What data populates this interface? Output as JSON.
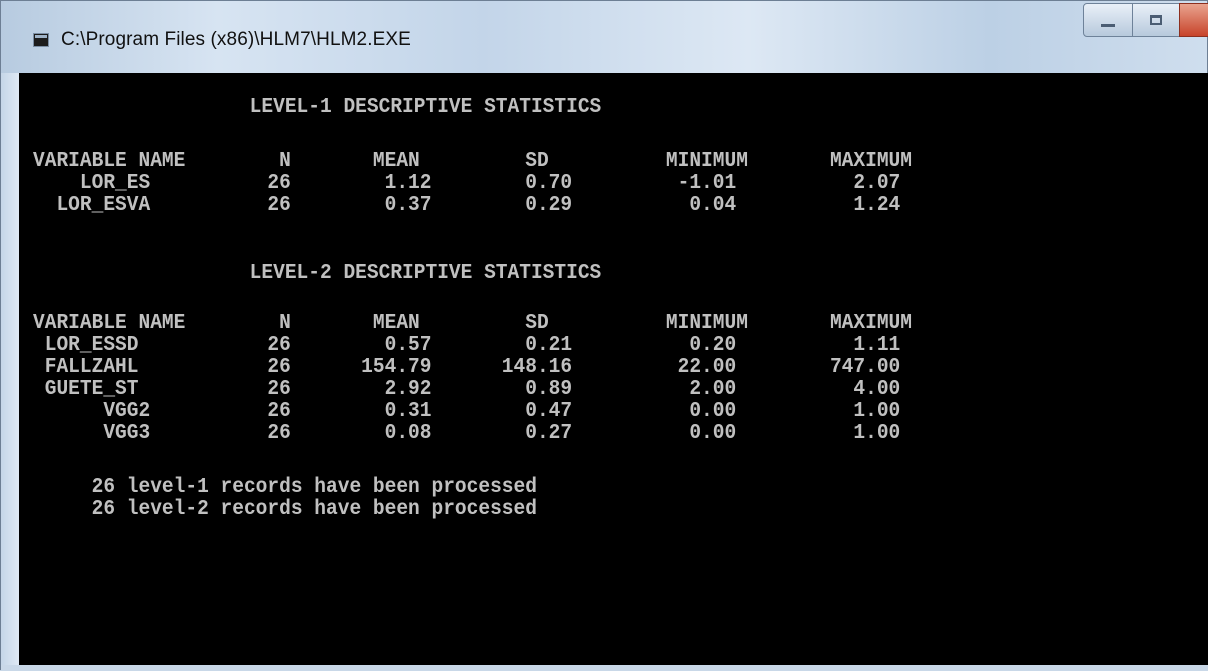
{
  "window": {
    "title": "C:\\Program Files (x86)\\HLM7\\HLM2.EXE",
    "icon": "console-app-icon",
    "controls": [
      "minimize-icon",
      "maximize-icon",
      "close-icon"
    ],
    "colors": {
      "console_bg": "#000000",
      "console_fg": "#c0c0c0",
      "close": "#c7432a"
    }
  },
  "console": {
    "lines": [
      "                   LEVEL-1 DESCRIPTIVE STATISTICS",
      "VARIABLE NAME        N       MEAN         SD          MINIMUM       MAXIMUM",
      "    LOR_ES          26        1.12        0.70         -1.01          2.07",
      "  LOR_ESVA          26        0.37        0.29          0.04          1.24",
      "                   LEVEL-2 DESCRIPTIVE STATISTICS",
      "VARIABLE NAME        N       MEAN         SD          MINIMUM       MAXIMUM",
      " LOR_ESSD           26        0.57        0.21          0.20          1.11",
      " FALLZAHL           26      154.79      148.16         22.00        747.00",
      " GUETE_ST           26        2.92        0.89          2.00          4.00",
      "      VGG2          26        0.31        0.47          0.00          1.00",
      "      VGG3          26        0.08        0.27          0.00          1.00",
      "     26 level-1 records have been processed",
      "     26 level-2 records have been processed"
    ]
  }
}
